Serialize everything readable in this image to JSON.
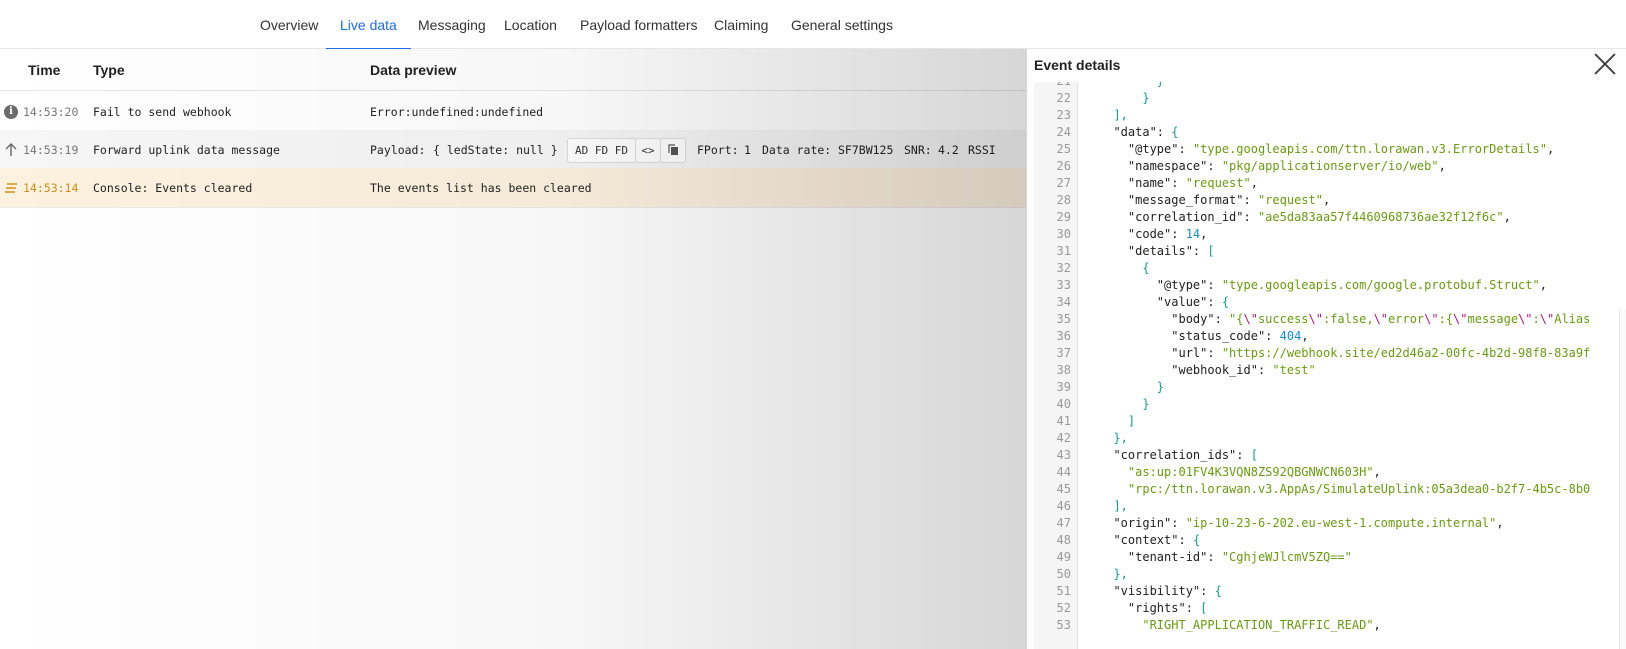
{
  "tabs": [
    {
      "label": "Overview",
      "active": false
    },
    {
      "label": "Live data",
      "active": true
    },
    {
      "label": "Messaging",
      "active": false
    },
    {
      "label": "Location",
      "active": false
    },
    {
      "label": "Payload formatters",
      "active": false
    },
    {
      "label": "Claiming",
      "active": false
    },
    {
      "label": "General settings",
      "active": false
    }
  ],
  "events_table": {
    "headers": {
      "time": "Time",
      "type": "Type",
      "preview": "Data preview"
    },
    "rows": [
      {
        "icon": "info-icon",
        "time": "14:53:20",
        "type": "Fail to send webhook",
        "preview": "Error:undefined:undefined"
      },
      {
        "icon": "arrow-up-icon",
        "time": "14:53:19",
        "type": "Forward uplink data message",
        "payload_label": "Payload:",
        "payload_value": "{ ledState: null }",
        "bytes": "AD FD FD",
        "fport_label": "FPort:",
        "fport_value": "1",
        "datarate_label": "Data rate:",
        "datarate_value": "SF7BW125",
        "snr_label": "SNR:",
        "snr_value": "4.2",
        "rssi_label": "RSSI"
      },
      {
        "icon": "events-cleared-icon",
        "time": "14:53:14",
        "type": "Console: Events cleared",
        "preview": "The events list has been cleared"
      }
    ]
  },
  "event_details": {
    "title": "Event details",
    "first_line": 21,
    "lines": [
      [
        [
          "br",
          "}"
        ],
        [
          "tx",
          "  "
        ]
      ],
      [
        [
          "br",
          "}"
        ]
      ],
      [
        [
          "br",
          "],"
        ]
      ],
      [
        [
          "tx",
          "\"data\": "
        ],
        [
          "br",
          "{"
        ]
      ],
      [
        [
          "tx",
          "\"@type\": "
        ],
        [
          "str",
          "\"type.googleapis.com/ttn.lorawan.v3.ErrorDetails\""
        ],
        [
          "tx",
          ","
        ]
      ],
      [
        [
          "tx",
          "\"namespace\": "
        ],
        [
          "str",
          "\"pkg/applicationserver/io/web\""
        ],
        [
          "tx",
          ","
        ]
      ],
      [
        [
          "tx",
          "\"name\": "
        ],
        [
          "str",
          "\"request\""
        ],
        [
          "tx",
          ","
        ]
      ],
      [
        [
          "tx",
          "\"message_format\": "
        ],
        [
          "str",
          "\"request\""
        ],
        [
          "tx",
          ","
        ]
      ],
      [
        [
          "tx",
          "\"correlation_id\": "
        ],
        [
          "str",
          "\"ae5da83aa57f4460968736ae32f12f6c\""
        ],
        [
          "tx",
          ","
        ]
      ],
      [
        [
          "tx",
          "\"code\": "
        ],
        [
          "num",
          "14"
        ],
        [
          "tx",
          ","
        ]
      ],
      [
        [
          "tx",
          "\"details\": "
        ],
        [
          "br",
          "["
        ]
      ],
      [
        [
          "br",
          "{"
        ]
      ],
      [
        [
          "tx",
          "\"@type\": "
        ],
        [
          "str",
          "\"type.googleapis.com/google.protobuf.Struct\""
        ],
        [
          "tx",
          ","
        ]
      ],
      [
        [
          "tx",
          "\"value\": "
        ],
        [
          "br",
          "{"
        ]
      ],
      [
        [
          "tx",
          "\"body\": "
        ],
        [
          "str",
          "\"{"
        ],
        [
          "esc",
          "\\\""
        ],
        [
          "str",
          "success"
        ],
        [
          "esc",
          "\\\""
        ],
        [
          "str",
          ":false,"
        ],
        [
          "esc",
          "\\\""
        ],
        [
          "str",
          "error"
        ],
        [
          "esc",
          "\\\""
        ],
        [
          "str",
          ":{"
        ],
        [
          "esc",
          "\\\""
        ],
        [
          "str",
          "message"
        ],
        [
          "esc",
          "\\\""
        ],
        [
          "str",
          ":"
        ],
        [
          "esc",
          "\\\""
        ],
        [
          "str",
          "Alias"
        ]
      ],
      [
        [
          "tx",
          "\"status_code\": "
        ],
        [
          "num",
          "404"
        ],
        [
          "tx",
          ","
        ]
      ],
      [
        [
          "tx",
          "\"url\": "
        ],
        [
          "str",
          "\"https://webhook.site/ed2d46a2-00fc-4b2d-98f8-83a9f"
        ]
      ],
      [
        [
          "tx",
          "\"webhook_id\": "
        ],
        [
          "str",
          "\"test\""
        ]
      ],
      [
        [
          "br",
          "}"
        ]
      ],
      [
        [
          "br",
          "}"
        ]
      ],
      [
        [
          "br",
          "]"
        ]
      ],
      [
        [
          "br",
          "},"
        ]
      ],
      [
        [
          "tx",
          "\"correlation_ids\": "
        ],
        [
          "br",
          "["
        ]
      ],
      [
        [
          "str",
          "\"as:up:01FV4K3VQN8ZS92QBGNWCN603H\""
        ],
        [
          "tx",
          ","
        ]
      ],
      [
        [
          "str",
          "\"rpc:/ttn.lorawan.v3.AppAs/SimulateUplink:05a3dea0-b2f7-4b5c-8b0"
        ]
      ],
      [
        [
          "br",
          "],"
        ]
      ],
      [
        [
          "tx",
          "\"origin\": "
        ],
        [
          "str",
          "\"ip-10-23-6-202.eu-west-1.compute.internal\""
        ],
        [
          "tx",
          ","
        ]
      ],
      [
        [
          "tx",
          "\"context\": "
        ],
        [
          "br",
          "{"
        ]
      ],
      [
        [
          "tx",
          "\"tenant-id\": "
        ],
        [
          "str",
          "\"CghjeWJlcmV5ZQ==\""
        ]
      ],
      [
        [
          "br",
          "},"
        ]
      ],
      [
        [
          "tx",
          "\"visibility\": "
        ],
        [
          "br",
          "{"
        ]
      ],
      [
        [
          "tx",
          "\"rights\": "
        ],
        [
          "br",
          "["
        ]
      ],
      [
        [
          "str",
          "\"RIGHT_APPLICATION_TRAFFIC_READ\""
        ],
        [
          "tx",
          ","
        ]
      ]
    ]
  },
  "colors": {
    "accent": "#1f6de0",
    "warn_row": "#fdf1df",
    "warn_time": "#d08f1a",
    "json_string": "#6a9a15",
    "json_number": "#1a8ec9",
    "json_bracket": "#1a9a8a"
  }
}
